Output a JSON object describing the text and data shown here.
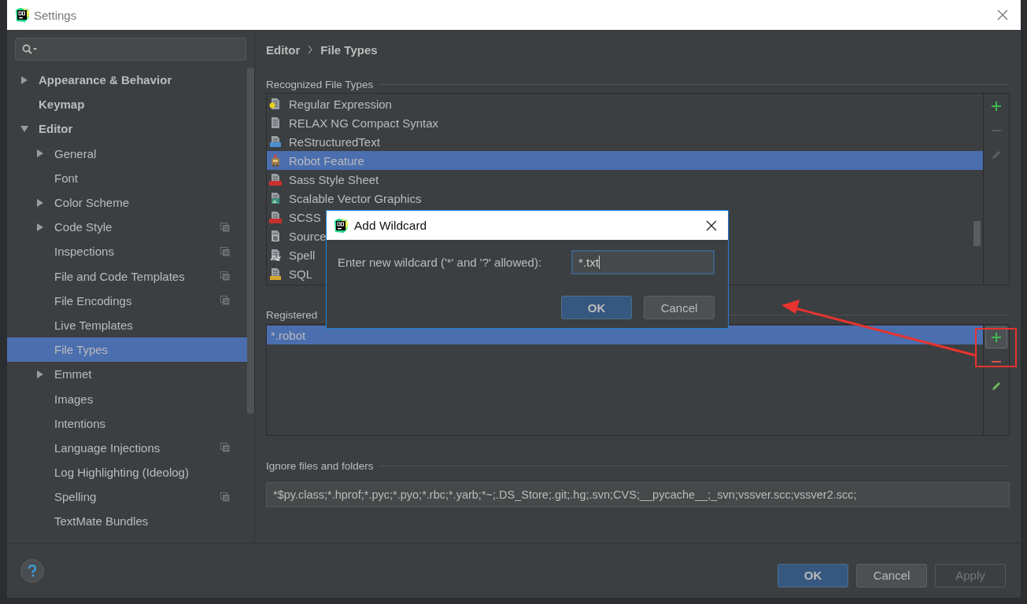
{
  "window": {
    "title": "Settings"
  },
  "sidebar": {
    "items": [
      {
        "label": "Appearance & Behavior",
        "expandable": true,
        "expanded": false,
        "project_scope": false,
        "selected": false
      },
      {
        "label": "Keymap",
        "expandable": false,
        "project_scope": false,
        "selected": false
      },
      {
        "label": "Editor",
        "expandable": true,
        "expanded": true,
        "project_scope": false,
        "selected": false,
        "children": [
          {
            "label": "General",
            "expandable": true,
            "expanded": false,
            "project_scope": false,
            "selected": false
          },
          {
            "label": "Font",
            "expandable": false,
            "project_scope": false,
            "selected": false
          },
          {
            "label": "Color Scheme",
            "expandable": true,
            "expanded": false,
            "project_scope": false,
            "selected": false
          },
          {
            "label": "Code Style",
            "expandable": true,
            "expanded": false,
            "project_scope": true,
            "selected": false
          },
          {
            "label": "Inspections",
            "expandable": false,
            "project_scope": true,
            "selected": false
          },
          {
            "label": "File and Code Templates",
            "expandable": false,
            "project_scope": true,
            "selected": false
          },
          {
            "label": "File Encodings",
            "expandable": false,
            "project_scope": true,
            "selected": false
          },
          {
            "label": "Live Templates",
            "expandable": false,
            "project_scope": false,
            "selected": false
          },
          {
            "label": "File Types",
            "expandable": false,
            "project_scope": false,
            "selected": true
          },
          {
            "label": "Emmet",
            "expandable": true,
            "expanded": false,
            "project_scope": false,
            "selected": false
          },
          {
            "label": "Images",
            "expandable": false,
            "project_scope": false,
            "selected": false
          },
          {
            "label": "Intentions",
            "expandable": false,
            "project_scope": false,
            "selected": false
          },
          {
            "label": "Language Injections",
            "expandable": false,
            "project_scope": true,
            "selected": false
          },
          {
            "label": "Log Highlighting (Ideolog)",
            "expandable": false,
            "project_scope": false,
            "selected": false
          },
          {
            "label": "Spelling",
            "expandable": false,
            "project_scope": true,
            "selected": false
          },
          {
            "label": "TextMate Bundles",
            "expandable": false,
            "project_scope": false,
            "selected": false
          }
        ]
      }
    ]
  },
  "breadcrumb": [
    "Editor",
    "File Types"
  ],
  "recognized": {
    "title": "Recognized File Types",
    "items": [
      {
        "label": "Regular Expression",
        "kind": "regex",
        "selected": false
      },
      {
        "label": "RELAX NG Compact Syntax",
        "kind": "doc",
        "selected": false
      },
      {
        "label": "ReStructuredText",
        "kind": "rst",
        "selected": false
      },
      {
        "label": "Robot Feature",
        "kind": "robot",
        "selected": true
      },
      {
        "label": "Sass Style Sheet",
        "kind": "sass",
        "selected": false
      },
      {
        "label": "Scalable Vector Graphics",
        "kind": "image",
        "selected": false
      },
      {
        "label": "SCSS",
        "kind": "sass",
        "selected": false
      },
      {
        "label": "Source",
        "kind": "source",
        "selected": false
      },
      {
        "label": "Spell",
        "kind": "spell",
        "selected": false
      },
      {
        "label": "SQL",
        "kind": "sql",
        "selected": false
      }
    ],
    "toolbar": [
      {
        "kind": "add",
        "disabled": false,
        "hovered": false
      },
      {
        "kind": "remove",
        "disabled": true,
        "hovered": false
      },
      {
        "kind": "edit",
        "disabled": true,
        "hovered": false
      }
    ]
  },
  "registered": {
    "title": "Registered",
    "items": [
      {
        "label": "*.robot",
        "selected": true
      }
    ],
    "toolbar": [
      {
        "kind": "add",
        "disabled": false,
        "hovered": true
      },
      {
        "kind": "remove",
        "disabled": false,
        "hovered": false
      },
      {
        "kind": "edit",
        "disabled": false,
        "hovered": false
      }
    ]
  },
  "ignore": {
    "title": "Ignore files and folders",
    "value": "*$py.class;*.hprof;*.pyc;*.pyo;*.rbc;*.yarb;*~;.DS_Store;.git;.hg;.svn;CVS;__pycache__;_svn;vssver.scc;vssver2.scc;"
  },
  "buttons": [
    {
      "label": "OK",
      "kind": "default",
      "disabled": false
    },
    {
      "label": "Cancel",
      "kind": "normal",
      "disabled": false
    },
    {
      "label": "Apply",
      "kind": "normal",
      "disabled": true
    }
  ],
  "dialog": {
    "title": "Add Wildcard",
    "prompt": "Enter new wildcard ('*' and '?' allowed):",
    "value": "*.txt",
    "buttons": [
      {
        "label": "OK",
        "kind": "default",
        "disabled": false
      },
      {
        "label": "Cancel",
        "kind": "normal",
        "disabled": false
      }
    ]
  }
}
